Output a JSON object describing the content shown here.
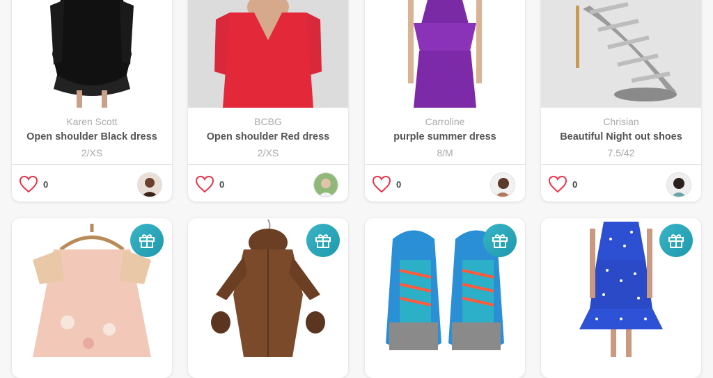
{
  "listings": [
    {
      "brand": "Karen Scott",
      "title": "Open shoulder Black dress",
      "size": "2/XS",
      "likes": "0"
    },
    {
      "brand": "BCBG",
      "title": "Open shoulder Red dress",
      "size": "2/XS",
      "likes": "0"
    },
    {
      "brand": "Carroline",
      "title": "purple summer dress",
      "size": "8/M",
      "likes": "0"
    },
    {
      "brand": "Chrisian",
      "title": "Beautiful Night out shoes",
      "size": "7.5/42",
      "likes": "0"
    }
  ],
  "gift_listings": [
    {
      "icon": "gift-icon",
      "item": "baby-dress"
    },
    {
      "icon": "gift-icon",
      "item": "snowsuit"
    },
    {
      "icon": "gift-icon",
      "item": "sneakers"
    },
    {
      "icon": "gift-icon",
      "item": "polka-dot-dress"
    }
  ],
  "colors": {
    "heart": "#e8334a",
    "gift_badge": "#2aa8bb"
  }
}
